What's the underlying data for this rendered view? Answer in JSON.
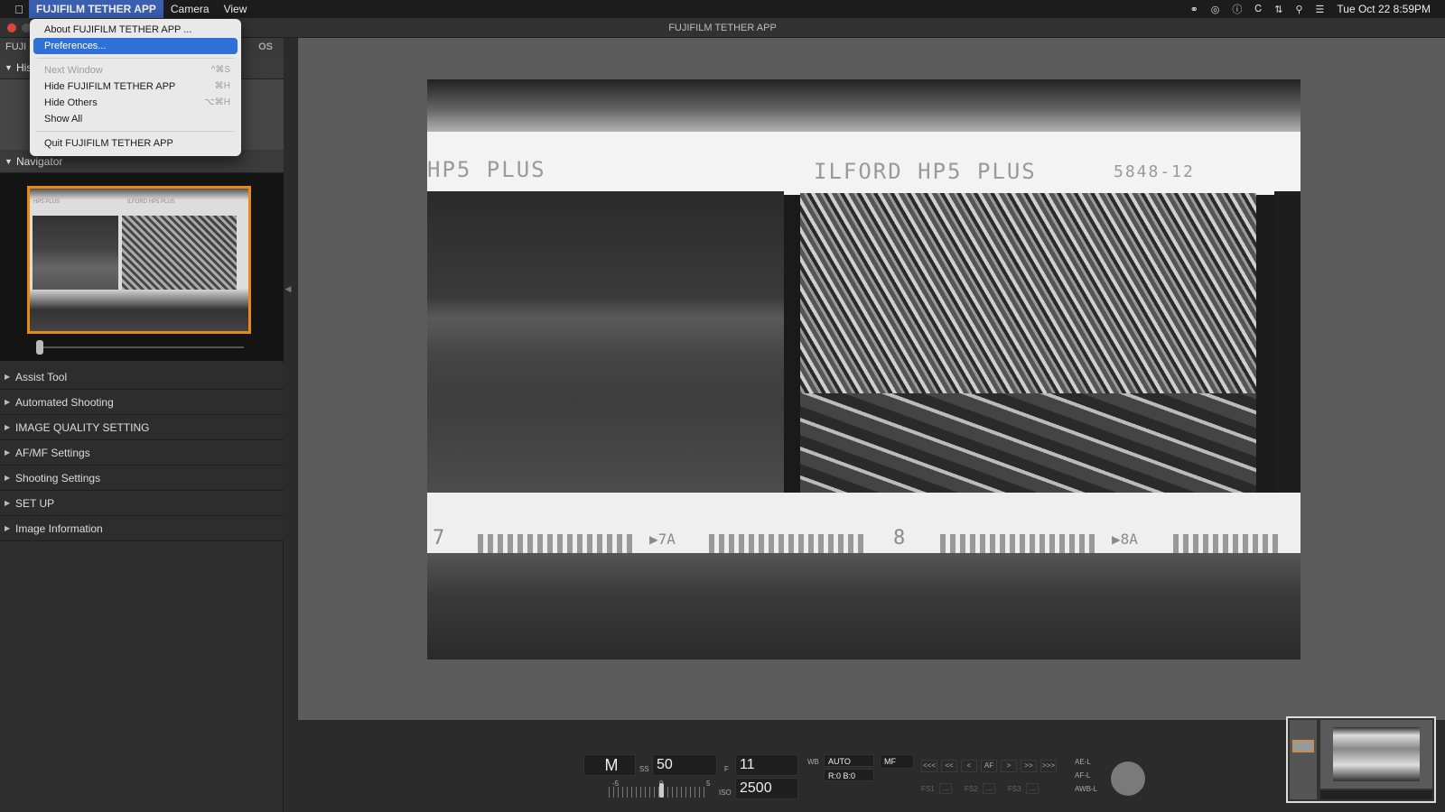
{
  "menubar": {
    "apple": "",
    "app_menu": "FUJIFILM TETHER APP",
    "menus": [
      "Camera",
      "View"
    ],
    "clock": "Tue Oct 22  8:59PM"
  },
  "window": {
    "title": "FUJIFILM TETHER APP",
    "logo_left": "FUJI",
    "logo_right": "OS"
  },
  "app_menu_dropdown": {
    "items": [
      {
        "label": "About FUJIFILM TETHER APP ...",
        "shortcut": "",
        "state": "normal"
      },
      {
        "label": "Preferences...",
        "shortcut": "",
        "state": "highlight"
      },
      {
        "label": "Next Window",
        "shortcut": "^⌘S",
        "state": "disabled"
      },
      {
        "label": "Hide FUJIFILM TETHER APP",
        "shortcut": "⌘H",
        "state": "normal"
      },
      {
        "label": "Hide Others",
        "shortcut": "⌥⌘H",
        "state": "normal"
      },
      {
        "label": "Show All",
        "shortcut": "",
        "state": "normal"
      },
      {
        "label": "Quit FUJIFILM TETHER APP",
        "shortcut": "",
        "state": "normal"
      }
    ]
  },
  "sidebar": {
    "history_label": "His",
    "navigator_label": "Navigator",
    "navigator_caption_left": "HP5 PLUS",
    "navigator_caption_right": "ILFORD HP5 PLUS",
    "panels": [
      "Assist Tool",
      "Automated Shooting",
      "IMAGE QUALITY SETTING",
      "AF/MF Settings",
      "Shooting Settings",
      "SET UP",
      "Image Information"
    ]
  },
  "photo": {
    "film_text_left": "HP5 PLUS",
    "film_text_right": "ILFORD HP5 PLUS",
    "film_code": "5848-12",
    "edge_numbers": [
      "7",
      "▶7A",
      "8",
      "▶8A"
    ]
  },
  "controls": {
    "mode": "M",
    "ss_label": "SS",
    "ss_value": "50",
    "f_label": "F",
    "f_value": "11",
    "iso_label": "ISO",
    "iso_value": "2500",
    "wb_label": "WB",
    "wb_value": "AUTO",
    "wb_shift": "R:0 B:0",
    "focus_mode": "MF",
    "ev_min": "-5",
    "ev_zero": "0",
    "ev_max": "5",
    "af_buttons": [
      "<<<",
      "<<",
      "<",
      "AF",
      ">",
      ">>",
      ">>>"
    ],
    "fs_labels": [
      "FS1",
      "FS2",
      "FS3"
    ],
    "fs_dots": "...",
    "ae_l": "AE-L",
    "af_l": "AF-L",
    "awb_l": "AWB-L"
  },
  "icons": {
    "status": [
      "link-icon",
      "cast-icon",
      "help-icon",
      "bluetooth-icon",
      "transfer-icon",
      "search-icon",
      "control-center-icon"
    ]
  }
}
